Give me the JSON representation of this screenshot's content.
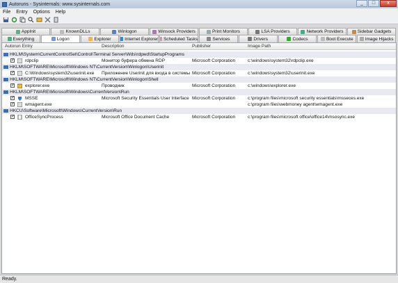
{
  "window": {
    "title": "Autoruns - Sysinternals: www.sysinternals.com",
    "minimize": "_",
    "maximize": "□",
    "close": "x"
  },
  "menu": [
    "File",
    "Entry",
    "Options",
    "Help"
  ],
  "tabs_row1": [
    "AppInit",
    "KnownDLLs",
    "Winlogon",
    "Winsock Providers",
    "Print Monitors",
    "LSA Providers",
    "Network Providers",
    "Sidebar Gadgets"
  ],
  "tabs_row2": [
    "Everything",
    "Logon",
    "Explorer",
    "Internet Explorer",
    "Scheduled Tasks",
    "Services",
    "Drivers",
    "Codecs",
    "Boot Execute",
    "Image Hijacks"
  ],
  "active_tab": "Logon",
  "columns": [
    "Autorun Entry",
    "Description",
    "Publisher",
    "Image Path"
  ],
  "groups": [
    {
      "key": "HKLM\\System\\CurrentControlSet\\Control\\Terminal Server\\Wds\\rdpwd\\StartupPrograms",
      "entries": [
        {
          "name": "rdpclip",
          "description": "Монитор буфера обмена RDP",
          "publisher": "Microsoft Corporation",
          "path": "c:\\windows\\system32\\rdpclip.exe"
        }
      ]
    },
    {
      "key": "HKLM\\SOFTWARE\\Microsoft\\Windows NT\\CurrentVersion\\Winlogon\\Userinit",
      "entries": [
        {
          "name": "C:\\Windows\\system32\\userinit.exe",
          "description": "Приложение Userinit для входа в системы",
          "publisher": "Microsoft Corporation",
          "path": "c:\\windows\\system32\\userinit.exe"
        }
      ]
    },
    {
      "key": "HKLM\\SOFTWARE\\Microsoft\\Windows NT\\CurrentVersion\\Winlogon\\Shell",
      "entries": [
        {
          "name": "explorer.exe",
          "description": "Проводник",
          "publisher": "Microsoft Corporation",
          "path": "c:\\windows\\explorer.exe"
        }
      ]
    },
    {
      "key": "HKLM\\SOFTWARE\\Microsoft\\Windows\\CurrentVersion\\Run",
      "entries": [
        {
          "name": "MSSE",
          "description": "Microsoft Security Essentials User Interface",
          "publisher": "Microsoft Corporation",
          "path": "c:\\program files\\microsoft security essentials\\msseces.exe"
        },
        {
          "name": "wmagent.exe",
          "description": "",
          "publisher": "",
          "path": "c:\\program files\\webmoney agent\\wmagent.exe"
        }
      ]
    },
    {
      "key": "HKCU\\Software\\Microsoft\\Windows\\CurrentVersion\\Run",
      "entries": [
        {
          "name": "OfficeSyncProcess",
          "description": "Microsoft Office Document Cache",
          "publisher": "Microsoft Corporation",
          "path": "c:\\program files\\microsoft office\\office14\\msosync.exe"
        }
      ]
    }
  ],
  "status": "Ready.",
  "icons": [
    "save-icon",
    "refresh-icon",
    "copy-icon",
    "find-icon",
    "jump-icon",
    "delete-icon",
    "properties-icon",
    "registry-icon",
    "folder-icon"
  ]
}
